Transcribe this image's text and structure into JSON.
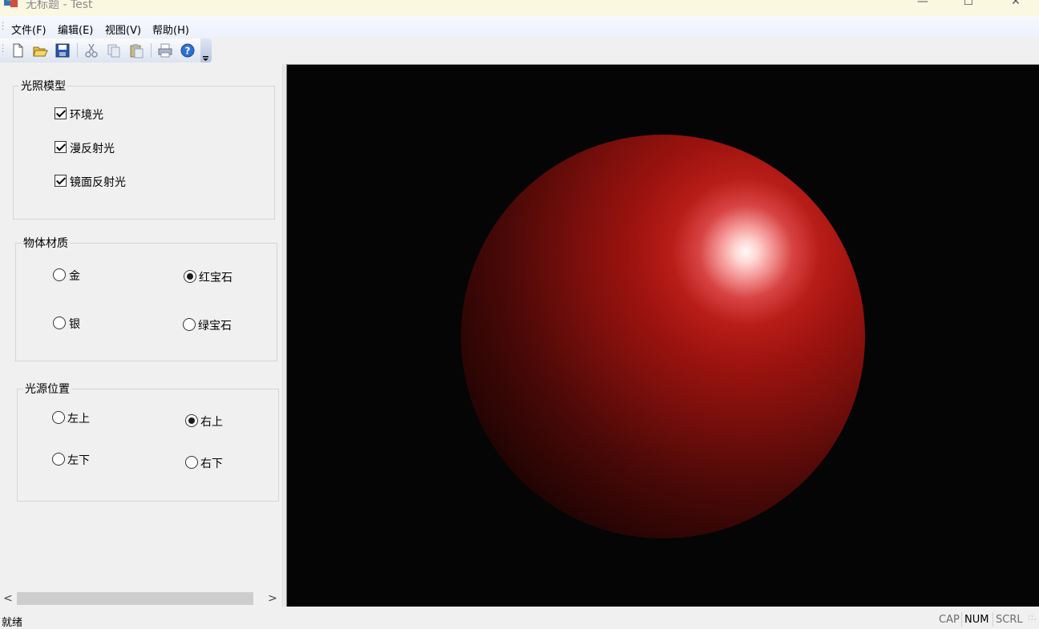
{
  "window": {
    "title": "无标题 - Test",
    "controls": {
      "minimize": "—",
      "maximize": "☐",
      "close": "✕"
    }
  },
  "menubar": {
    "items": [
      "文件(F)",
      "编辑(E)",
      "视图(V)",
      "帮助(H)"
    ]
  },
  "toolbar": {
    "buttons": [
      "new-icon",
      "open-icon",
      "save-icon",
      "cut-icon",
      "copy-icon",
      "paste-icon",
      "print-icon",
      "help-icon"
    ]
  },
  "panel": {
    "lighting_model": {
      "title": "光照模型",
      "options": [
        {
          "label": "环境光",
          "checked": true
        },
        {
          "label": "漫反射光",
          "checked": true
        },
        {
          "label": "镜面反射光",
          "checked": true
        }
      ]
    },
    "material": {
      "title": "物体材质",
      "options": [
        {
          "label": "金",
          "selected": false
        },
        {
          "label": "红宝石",
          "selected": true
        },
        {
          "label": "银",
          "selected": false
        },
        {
          "label": "绿宝石",
          "selected": false
        }
      ]
    },
    "light_position": {
      "title": "光源位置",
      "options": [
        {
          "label": "左上",
          "selected": false
        },
        {
          "label": "右上",
          "selected": true
        },
        {
          "label": "左下",
          "selected": false
        },
        {
          "label": "右下",
          "selected": false
        }
      ]
    },
    "scroll": {
      "left": "<",
      "right": ">"
    }
  },
  "viewport": {
    "background": "#050505",
    "sphere_color": "#b81d18",
    "highlight_color": "#fffafa"
  },
  "statusbar": {
    "text": "就绪",
    "indicators": [
      "CAP",
      "NUM",
      "SCRL"
    ]
  }
}
